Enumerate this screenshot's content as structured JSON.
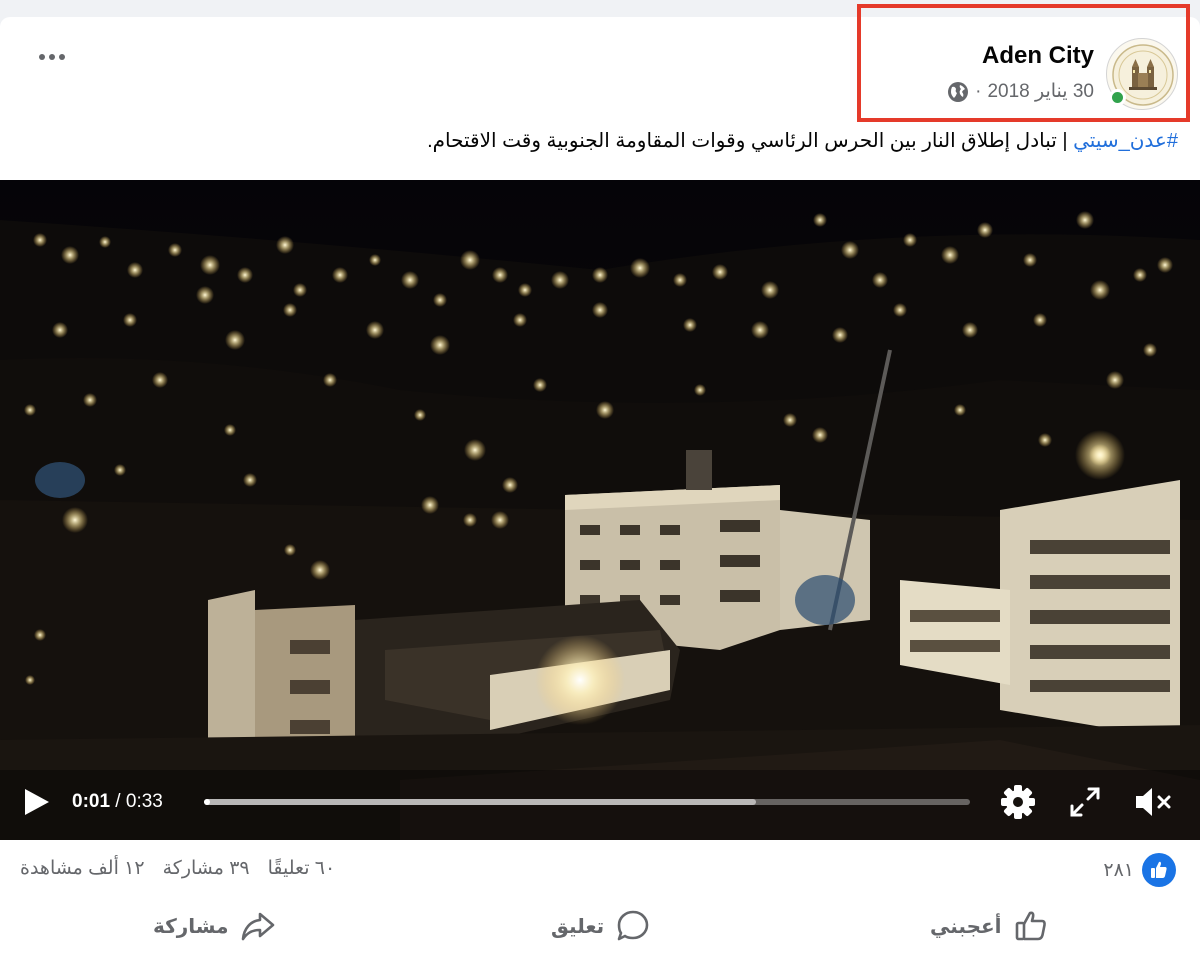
{
  "post": {
    "page_name": "Aden City",
    "date": "30 يناير 2018",
    "separator": "·",
    "privacy_icon": "globe-icon",
    "avatar_icon": "aden-city-logo",
    "more_icon": "more-dots-icon",
    "caption_hashtag": "#عدن_سيتي",
    "caption_divider": " | ",
    "caption_text": "تبادل إطلاق النار بين الحرس الرئاسي وقوات المقاومة الجنوبية وقت الاقتحام."
  },
  "video": {
    "current_time": "0:01",
    "time_separator": " / ",
    "duration": "0:33",
    "played_fraction": 0.005,
    "buffered_fraction": 0.72,
    "controls": [
      "play-icon",
      "gear-icon",
      "fullscreen-icon",
      "mute-icon"
    ]
  },
  "stats": {
    "reaction_count": "٢٨١",
    "comments": "٦٠ تعليقًا",
    "shares": "٣٩ مشاركة",
    "views": "١٢ ألف مشاهدة"
  },
  "actions": {
    "like_label": "أعجبني",
    "comment_label": "تعليق",
    "share_label": "مشاركة"
  },
  "colors": {
    "hashtag": "#216fdb",
    "like_blue": "#1a74e5",
    "highlight_border": "#e53a2a",
    "online": "#31a24c"
  }
}
